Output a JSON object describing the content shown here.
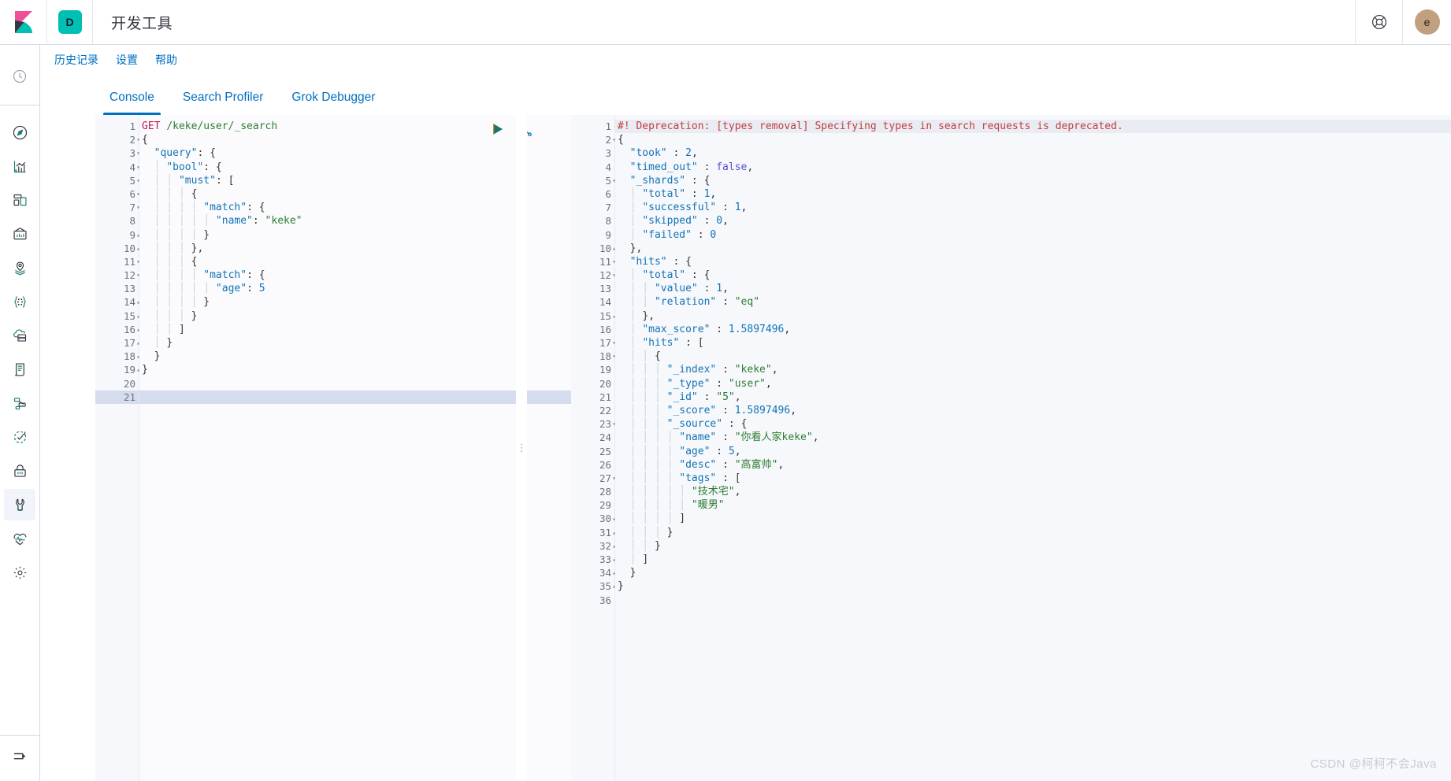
{
  "header": {
    "logo_icon": "kibana-logo",
    "space_badge": "D",
    "title": "开发工具",
    "help_icon": "help-lifebuoy-icon",
    "avatar_initial": "e"
  },
  "sidebar": {
    "items": [
      {
        "name": "recently-viewed",
        "icon": "clock-icon"
      },
      {
        "name": "discover",
        "icon": "compass-icon"
      },
      {
        "name": "visualize",
        "icon": "visualize-chart-icon"
      },
      {
        "name": "dashboard",
        "icon": "dashboard-grid-icon"
      },
      {
        "name": "canvas",
        "icon": "canvas-frame-icon"
      },
      {
        "name": "maps",
        "icon": "map-pin-layers-icon"
      },
      {
        "name": "machine-learning",
        "icon": "ml-nodes-icon"
      },
      {
        "name": "infrastructure",
        "icon": "cloud-server-icon"
      },
      {
        "name": "logs",
        "icon": "document-scroll-icon"
      },
      {
        "name": "apm",
        "icon": "apm-trace-icon"
      },
      {
        "name": "uptime",
        "icon": "uptime-check-icon"
      },
      {
        "name": "security",
        "icon": "lock-icon"
      },
      {
        "name": "dev-tools",
        "icon": "wrench-icon",
        "active": true
      },
      {
        "name": "monitoring",
        "icon": "heartbeat-icon"
      },
      {
        "name": "management",
        "icon": "gear-icon"
      }
    ],
    "collapse_icon": "collapse-arrow-icon"
  },
  "topnav": {
    "links": [
      {
        "label": "历史记录",
        "name": "history-link"
      },
      {
        "label": "设置",
        "name": "settings-link"
      },
      {
        "label": "帮助",
        "name": "help-link"
      }
    ]
  },
  "tabs": [
    {
      "label": "Console",
      "name": "tab-console",
      "active": true
    },
    {
      "label": "Search Profiler",
      "name": "tab-search-profiler",
      "active": false
    },
    {
      "label": "Grok Debugger",
      "name": "tab-grok-debugger",
      "active": false
    }
  ],
  "editor_actions": {
    "play_icon": "play-triangle-icon",
    "wrench_icon": "wrench-tools-icon"
  },
  "request": {
    "total_lines": 21,
    "current_line": 21,
    "fold_markers": {
      "2": "open",
      "3": "open",
      "4": "open",
      "5": "open",
      "6": "open",
      "7": "open",
      "9": "close",
      "10": "close",
      "11": "open",
      "12": "open",
      "14": "close",
      "15": "close",
      "16": "close",
      "17": "close",
      "18": "close",
      "19": "close"
    },
    "lines": [
      [
        {
          "t": "method",
          "v": "GET"
        },
        {
          "t": "plain",
          "v": " "
        },
        {
          "t": "url",
          "v": "/keke/user/_search"
        }
      ],
      [
        {
          "t": "punc",
          "v": "{"
        }
      ],
      [
        {
          "t": "plain",
          "v": "  "
        },
        {
          "t": "key",
          "v": "\"query\""
        },
        {
          "t": "punc",
          "v": ": {"
        }
      ],
      [
        {
          "t": "ind",
          "v": "  │ "
        },
        {
          "t": "key",
          "v": "\"bool\""
        },
        {
          "t": "punc",
          "v": ": {"
        }
      ],
      [
        {
          "t": "ind",
          "v": "  │ │ "
        },
        {
          "t": "key",
          "v": "\"must\""
        },
        {
          "t": "punc",
          "v": ": ["
        }
      ],
      [
        {
          "t": "ind",
          "v": "  │ │ │ "
        },
        {
          "t": "punc",
          "v": "{"
        }
      ],
      [
        {
          "t": "ind",
          "v": "  │ │ │ │ "
        },
        {
          "t": "key",
          "v": "\"match\""
        },
        {
          "t": "punc",
          "v": ": {"
        }
      ],
      [
        {
          "t": "ind",
          "v": "  │ │ │ │ │ "
        },
        {
          "t": "key",
          "v": "\"name\""
        },
        {
          "t": "punc",
          "v": ": "
        },
        {
          "t": "str",
          "v": "\"keke\""
        }
      ],
      [
        {
          "t": "ind",
          "v": "  │ │ │ │ "
        },
        {
          "t": "punc",
          "v": "}"
        }
      ],
      [
        {
          "t": "ind",
          "v": "  │ │ │ "
        },
        {
          "t": "punc",
          "v": "},"
        }
      ],
      [
        {
          "t": "ind",
          "v": "  │ │ │ "
        },
        {
          "t": "punc",
          "v": "{"
        }
      ],
      [
        {
          "t": "ind",
          "v": "  │ │ │ │ "
        },
        {
          "t": "key",
          "v": "\"match\""
        },
        {
          "t": "punc",
          "v": ": {"
        }
      ],
      [
        {
          "t": "ind",
          "v": "  │ │ │ │ │ "
        },
        {
          "t": "key",
          "v": "\"age\""
        },
        {
          "t": "punc",
          "v": ": "
        },
        {
          "t": "num",
          "v": "5"
        }
      ],
      [
        {
          "t": "ind",
          "v": "  │ │ │ │ "
        },
        {
          "t": "punc",
          "v": "}"
        }
      ],
      [
        {
          "t": "ind",
          "v": "  │ │ │ "
        },
        {
          "t": "punc",
          "v": "}"
        }
      ],
      [
        {
          "t": "ind",
          "v": "  │ │ "
        },
        {
          "t": "punc",
          "v": "]"
        }
      ],
      [
        {
          "t": "ind",
          "v": "  │ "
        },
        {
          "t": "punc",
          "v": "}"
        }
      ],
      [
        {
          "t": "plain",
          "v": "  "
        },
        {
          "t": "punc",
          "v": "}"
        }
      ],
      [
        {
          "t": "punc",
          "v": "}"
        }
      ],
      [],
      []
    ]
  },
  "response": {
    "total_lines": 36,
    "warning_line": 1,
    "warning_text": "#! Deprecation: [types removal] Specifying types in search requests is deprecated.",
    "fold_markers": {
      "2": "open",
      "5": "open",
      "10": "close",
      "11": "open",
      "12": "open",
      "15": "close",
      "17": "open",
      "18": "open",
      "23": "open",
      "27": "open",
      "30": "close",
      "31": "close",
      "32": "close",
      "33": "close",
      "34": "close",
      "35": "close"
    },
    "lines": [
      [
        {
          "t": "warn",
          "v": "#! Deprecation: [types removal] Specifying types in search requests is deprecated."
        }
      ],
      [
        {
          "t": "punc",
          "v": "{"
        }
      ],
      [
        {
          "t": "plain",
          "v": "  "
        },
        {
          "t": "key",
          "v": "\"took\""
        },
        {
          "t": "punc",
          "v": " : "
        },
        {
          "t": "num",
          "v": "2"
        },
        {
          "t": "punc",
          "v": ","
        }
      ],
      [
        {
          "t": "plain",
          "v": "  "
        },
        {
          "t": "key",
          "v": "\"timed_out\""
        },
        {
          "t": "punc",
          "v": " : "
        },
        {
          "t": "bool",
          "v": "false"
        },
        {
          "t": "punc",
          "v": ","
        }
      ],
      [
        {
          "t": "plain",
          "v": "  "
        },
        {
          "t": "key",
          "v": "\"_shards\""
        },
        {
          "t": "punc",
          "v": " : {"
        }
      ],
      [
        {
          "t": "ind",
          "v": "  │ "
        },
        {
          "t": "key",
          "v": "\"total\""
        },
        {
          "t": "punc",
          "v": " : "
        },
        {
          "t": "num",
          "v": "1"
        },
        {
          "t": "punc",
          "v": ","
        }
      ],
      [
        {
          "t": "ind",
          "v": "  │ "
        },
        {
          "t": "key",
          "v": "\"successful\""
        },
        {
          "t": "punc",
          "v": " : "
        },
        {
          "t": "num",
          "v": "1"
        },
        {
          "t": "punc",
          "v": ","
        }
      ],
      [
        {
          "t": "ind",
          "v": "  │ "
        },
        {
          "t": "key",
          "v": "\"skipped\""
        },
        {
          "t": "punc",
          "v": " : "
        },
        {
          "t": "num",
          "v": "0"
        },
        {
          "t": "punc",
          "v": ","
        }
      ],
      [
        {
          "t": "ind",
          "v": "  │ "
        },
        {
          "t": "key",
          "v": "\"failed\""
        },
        {
          "t": "punc",
          "v": " : "
        },
        {
          "t": "num",
          "v": "0"
        }
      ],
      [
        {
          "t": "plain",
          "v": "  "
        },
        {
          "t": "punc",
          "v": "},"
        }
      ],
      [
        {
          "t": "plain",
          "v": "  "
        },
        {
          "t": "key",
          "v": "\"hits\""
        },
        {
          "t": "punc",
          "v": " : {"
        }
      ],
      [
        {
          "t": "ind",
          "v": "  │ "
        },
        {
          "t": "key",
          "v": "\"total\""
        },
        {
          "t": "punc",
          "v": " : {"
        }
      ],
      [
        {
          "t": "ind",
          "v": "  │ │ "
        },
        {
          "t": "key",
          "v": "\"value\""
        },
        {
          "t": "punc",
          "v": " : "
        },
        {
          "t": "num",
          "v": "1"
        },
        {
          "t": "punc",
          "v": ","
        }
      ],
      [
        {
          "t": "ind",
          "v": "  │ │ "
        },
        {
          "t": "key",
          "v": "\"relation\""
        },
        {
          "t": "punc",
          "v": " : "
        },
        {
          "t": "str",
          "v": "\"eq\""
        }
      ],
      [
        {
          "t": "ind",
          "v": "  │ "
        },
        {
          "t": "punc",
          "v": "},"
        }
      ],
      [
        {
          "t": "ind",
          "v": "  │ "
        },
        {
          "t": "key",
          "v": "\"max_score\""
        },
        {
          "t": "punc",
          "v": " : "
        },
        {
          "t": "num",
          "v": "1.5897496"
        },
        {
          "t": "punc",
          "v": ","
        }
      ],
      [
        {
          "t": "ind",
          "v": "  │ "
        },
        {
          "t": "key",
          "v": "\"hits\""
        },
        {
          "t": "punc",
          "v": " : ["
        }
      ],
      [
        {
          "t": "ind",
          "v": "  │ │ "
        },
        {
          "t": "punc",
          "v": "{"
        }
      ],
      [
        {
          "t": "ind",
          "v": "  │ │ │ "
        },
        {
          "t": "key",
          "v": "\"_index\""
        },
        {
          "t": "punc",
          "v": " : "
        },
        {
          "t": "str",
          "v": "\"keke\""
        },
        {
          "t": "punc",
          "v": ","
        }
      ],
      [
        {
          "t": "ind",
          "v": "  │ │ │ "
        },
        {
          "t": "key",
          "v": "\"_type\""
        },
        {
          "t": "punc",
          "v": " : "
        },
        {
          "t": "str",
          "v": "\"user\""
        },
        {
          "t": "punc",
          "v": ","
        }
      ],
      [
        {
          "t": "ind",
          "v": "  │ │ │ "
        },
        {
          "t": "key",
          "v": "\"_id\""
        },
        {
          "t": "punc",
          "v": " : "
        },
        {
          "t": "str",
          "v": "\"5\""
        },
        {
          "t": "punc",
          "v": ","
        }
      ],
      [
        {
          "t": "ind",
          "v": "  │ │ │ "
        },
        {
          "t": "key",
          "v": "\"_score\""
        },
        {
          "t": "punc",
          "v": " : "
        },
        {
          "t": "num",
          "v": "1.5897496"
        },
        {
          "t": "punc",
          "v": ","
        }
      ],
      [
        {
          "t": "ind",
          "v": "  │ │ │ "
        },
        {
          "t": "key",
          "v": "\"_source\""
        },
        {
          "t": "punc",
          "v": " : {"
        }
      ],
      [
        {
          "t": "ind",
          "v": "  │ │ │ │ "
        },
        {
          "t": "key",
          "v": "\"name\""
        },
        {
          "t": "punc",
          "v": " : "
        },
        {
          "t": "str",
          "v": "\"你看人家keke\""
        },
        {
          "t": "punc",
          "v": ","
        }
      ],
      [
        {
          "t": "ind",
          "v": "  │ │ │ │ "
        },
        {
          "t": "key",
          "v": "\"age\""
        },
        {
          "t": "punc",
          "v": " : "
        },
        {
          "t": "num",
          "v": "5"
        },
        {
          "t": "punc",
          "v": ","
        }
      ],
      [
        {
          "t": "ind",
          "v": "  │ │ │ │ "
        },
        {
          "t": "key",
          "v": "\"desc\""
        },
        {
          "t": "punc",
          "v": " : "
        },
        {
          "t": "str",
          "v": "\"高富帅\""
        },
        {
          "t": "punc",
          "v": ","
        }
      ],
      [
        {
          "t": "ind",
          "v": "  │ │ │ │ "
        },
        {
          "t": "key",
          "v": "\"tags\""
        },
        {
          "t": "punc",
          "v": " : ["
        }
      ],
      [
        {
          "t": "ind",
          "v": "  │ │ │ │ │ "
        },
        {
          "t": "str",
          "v": "\"技术宅\""
        },
        {
          "t": "punc",
          "v": ","
        }
      ],
      [
        {
          "t": "ind",
          "v": "  │ │ │ │ │ "
        },
        {
          "t": "str",
          "v": "\"暖男\""
        }
      ],
      [
        {
          "t": "ind",
          "v": "  │ │ │ │ "
        },
        {
          "t": "punc",
          "v": "]"
        }
      ],
      [
        {
          "t": "ind",
          "v": "  │ │ │ "
        },
        {
          "t": "punc",
          "v": "}"
        }
      ],
      [
        {
          "t": "ind",
          "v": "  │ │ "
        },
        {
          "t": "punc",
          "v": "}"
        }
      ],
      [
        {
          "t": "ind",
          "v": "  │ "
        },
        {
          "t": "punc",
          "v": "]"
        }
      ],
      [
        {
          "t": "plain",
          "v": "  "
        },
        {
          "t": "punc",
          "v": "}"
        }
      ],
      [
        {
          "t": "punc",
          "v": "}"
        }
      ],
      []
    ]
  },
  "watermark": "CSDN @柯柯不会Java"
}
